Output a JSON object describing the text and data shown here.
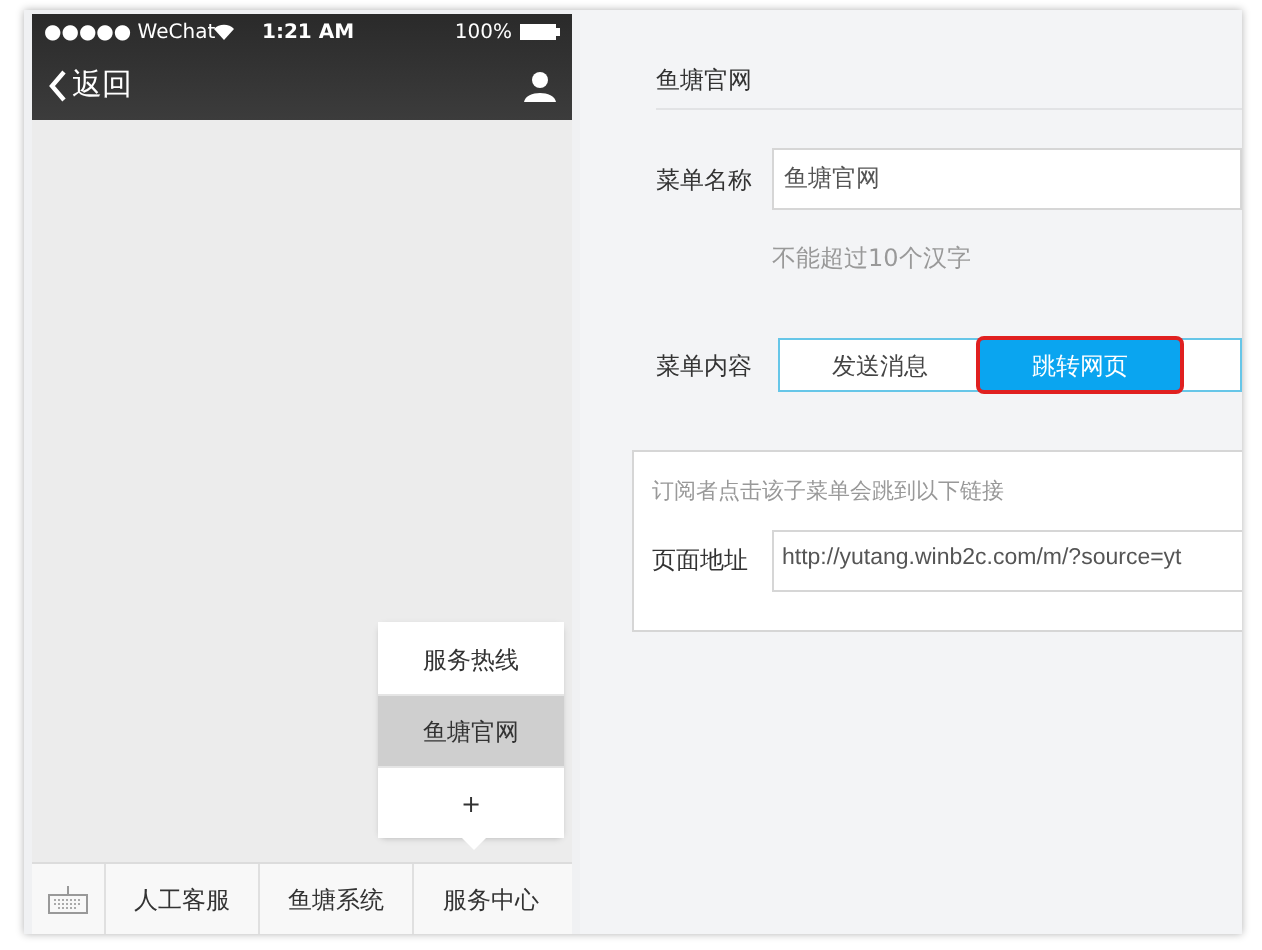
{
  "status_bar": {
    "carrier": "●●●●● WeChat",
    "time": "1:21 AM",
    "battery": "100%"
  },
  "nav": {
    "back": "返回"
  },
  "submenu": [
    {
      "label": "服务热线",
      "selected": false
    },
    {
      "label": "鱼塘官网",
      "selected": true
    },
    {
      "label": "+",
      "selected": false
    }
  ],
  "bottom_menu": [
    "人工客服",
    "鱼塘系统",
    "服务中心"
  ],
  "editor": {
    "title": "鱼塘官网",
    "name_label": "菜单名称",
    "name_value": "鱼塘官网",
    "name_hint": "不能超过10个汉字",
    "content_label": "菜单内容",
    "content_tabs": [
      {
        "label": "发送消息",
        "selected": false,
        "highlighted": false
      },
      {
        "label": "跳转网页",
        "selected": true,
        "highlighted": true
      }
    ],
    "link_hint": "订阅者点击该子菜单会跳到以下链接",
    "url_label": "页面地址",
    "url_value": "http://yutang.winb2c.com/m/?source=yt"
  }
}
